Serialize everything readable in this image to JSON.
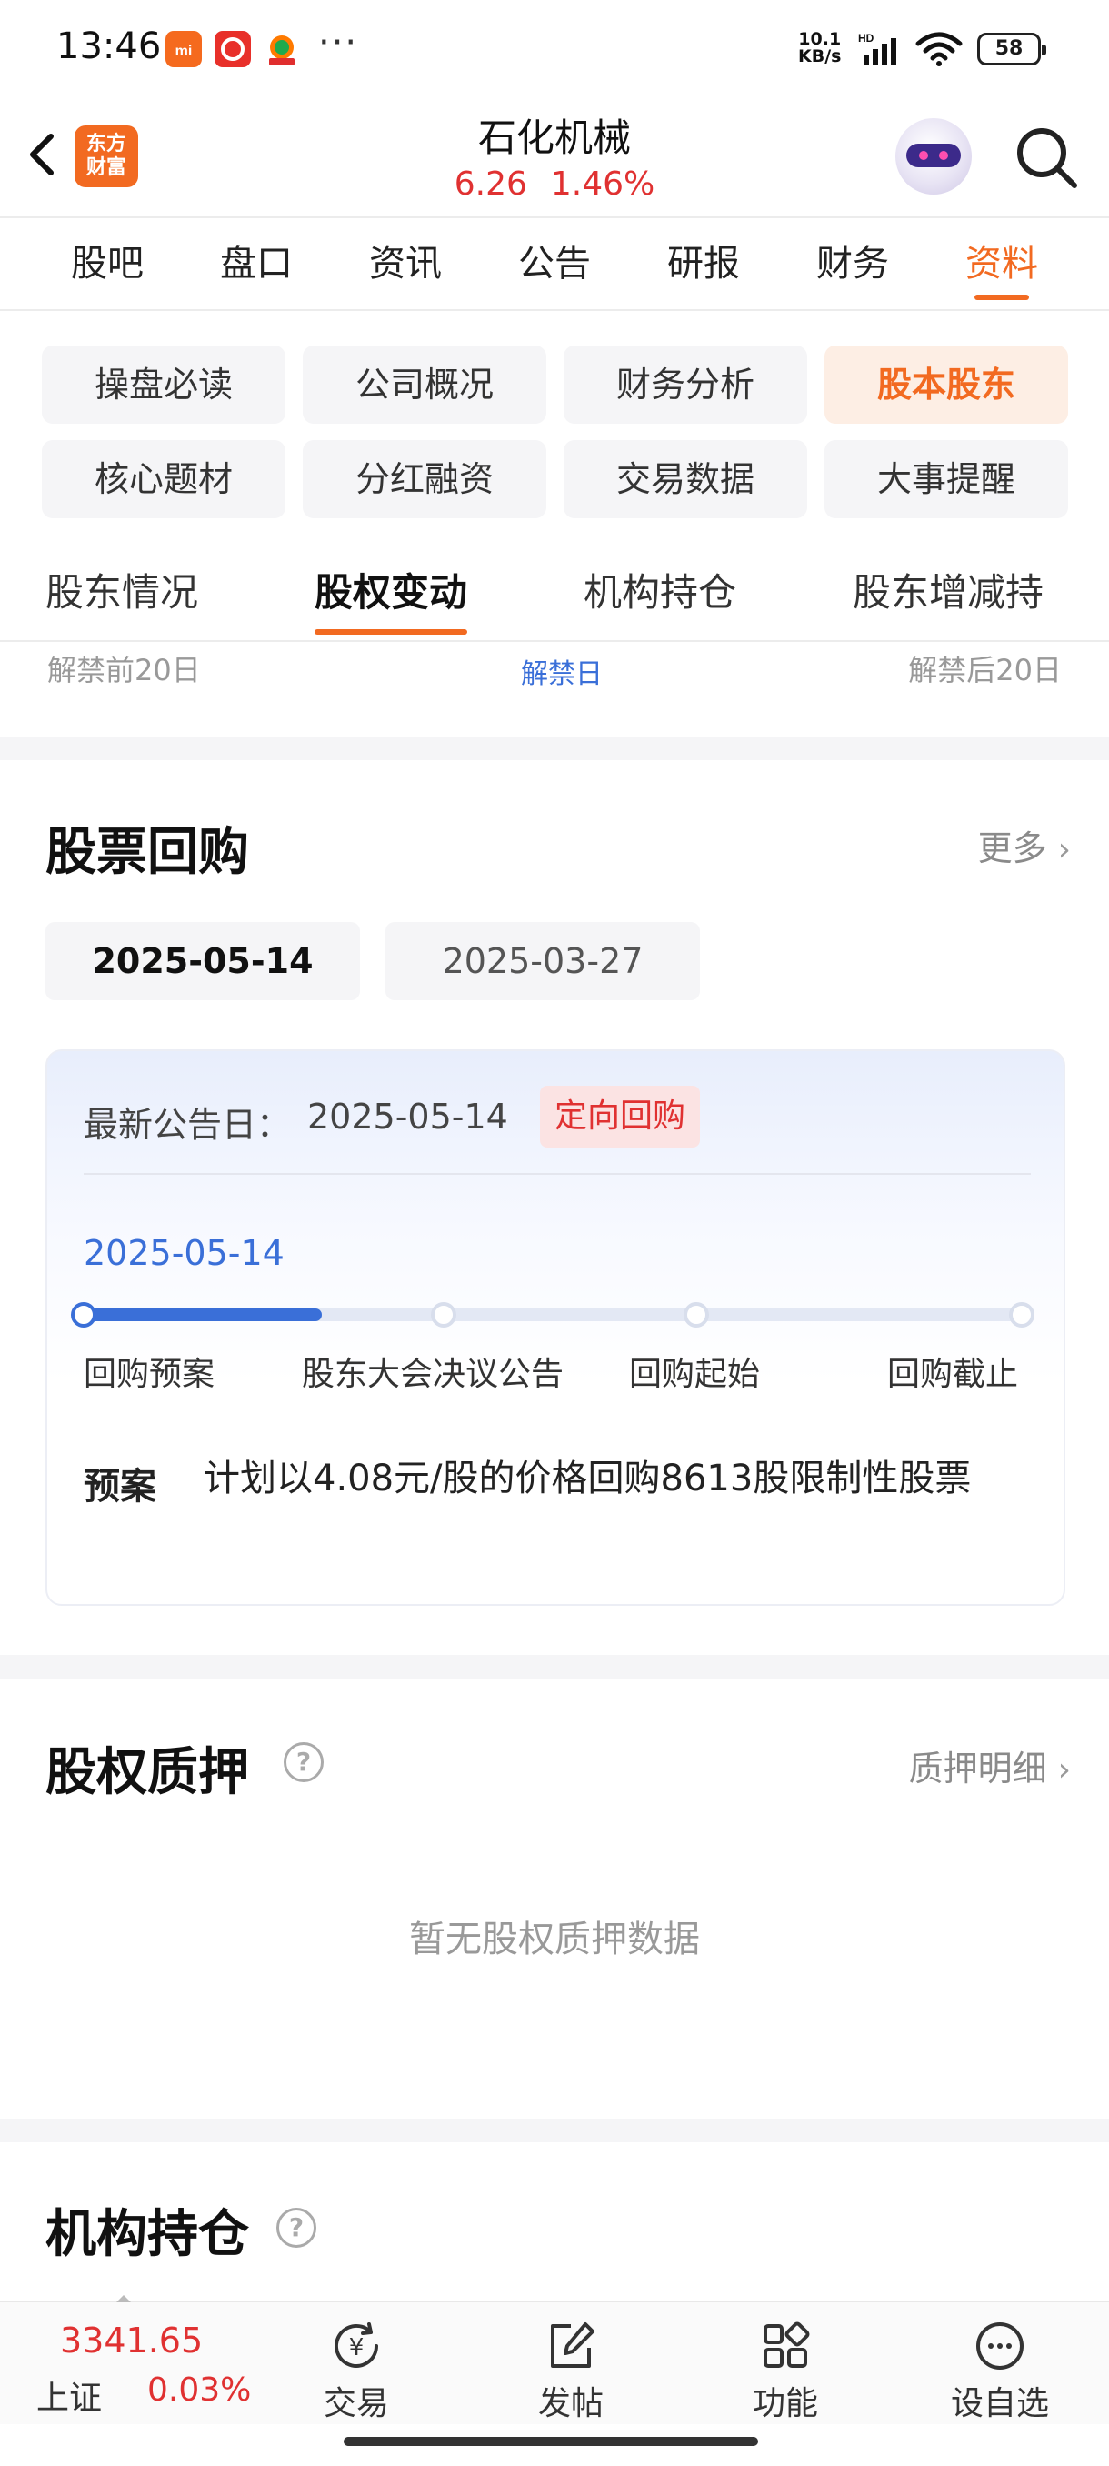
{
  "status_bar": {
    "time": "13:46",
    "more": "···",
    "net_speed_value": "10.1",
    "net_speed_unit": "KB/s",
    "network": "HD",
    "battery": "58"
  },
  "header": {
    "logo_line1": "东方",
    "logo_line2": "财富",
    "stock_name": "石化机械",
    "price": "6.26",
    "change_pct": "1.46%",
    "accent_color": "#f26a21",
    "rise_color": "#e03131"
  },
  "main_tabs": [
    "股吧",
    "盘口",
    "资讯",
    "公告",
    "研报",
    "财务",
    "资料"
  ],
  "main_tab_active": "资料",
  "sub_tabs": [
    "操盘必读",
    "公司概况",
    "财务分析",
    "股本股东",
    "核心题材",
    "分红融资",
    "交易数据",
    "大事提醒"
  ],
  "sub_tab_active": "股本股东",
  "section_tabs": [
    "股东情况",
    "股权变动",
    "机构持仓",
    "股东增减持"
  ],
  "section_tab_active": "股权变动",
  "unlock_axis": {
    "before": "解禁前20日",
    "day": "解禁日",
    "after": "解禁后20日"
  },
  "buyback": {
    "title": "股票回购",
    "more_label": "更多",
    "dates": [
      "2025-05-14",
      "2025-03-27"
    ],
    "active_date": "2025-05-14",
    "announce_label": "最新公告日：",
    "announce_date": "2025-05-14",
    "type_badge": "定向回购",
    "progress_date": "2025-05-14",
    "progress_fraction": 0.25,
    "steps": [
      "回购预案",
      "股东大会决议公告",
      "回购起始",
      "回购截止"
    ],
    "plan_label": "预案",
    "plan_text": "计划以4.08元/股的价格回购8613股限制性股票"
  },
  "pledge": {
    "title": "股权质押",
    "more_label": "质押明细",
    "empty_text": "暂无股权质押数据"
  },
  "institutional": {
    "title": "机构持仓"
  },
  "bottom_nav": {
    "index_price": "3341.65",
    "index_name": "上证",
    "index_change": "0.03%",
    "items": [
      "交易",
      "发帖",
      "功能",
      "设自选"
    ]
  }
}
